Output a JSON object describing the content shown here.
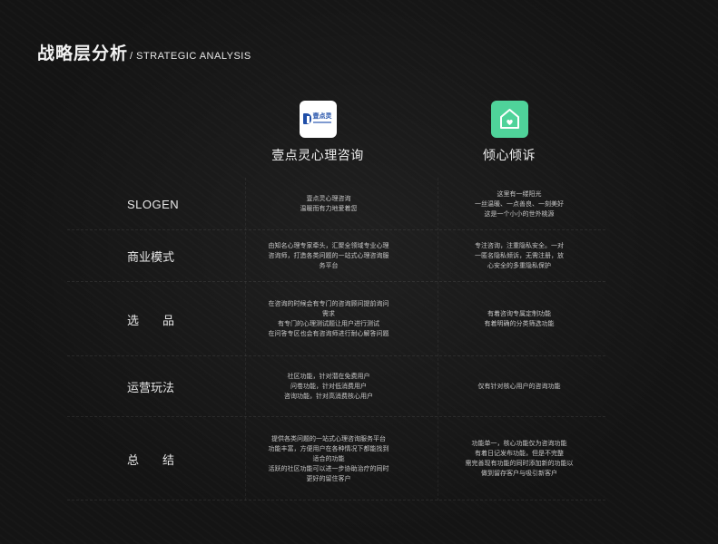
{
  "header": {
    "title_cn": "战略层分析",
    "title_en": "/ STRATEGIC ANALYSIS"
  },
  "apps": [
    {
      "name": "壹点灵心理咨询",
      "icon": "yidianling-logo-icon",
      "logo_text": "壹点灵",
      "brand_color": "#1f4ea8"
    },
    {
      "name": "倾心倾诉",
      "icon": "house-heart-icon",
      "brand_color": "#4fd39a"
    }
  ],
  "rows": [
    {
      "label": "SLOGEN",
      "col1": [
        "壹点灵心理咨询",
        "温暖而有力地爱着您"
      ],
      "col2": [
        "这里有一缕阳光",
        "一丝温暖、一点善良、一刻美好",
        "这是一个小小的世外桃源"
      ]
    },
    {
      "label": "商业模式",
      "col1": [
        "由知名心理专家牵头，汇聚全领域专业心理",
        "咨询师，打造各类问题的一站式心理咨询服",
        "务平台"
      ],
      "col2": [
        "专注咨询，注重隐私安全。一对",
        "一匿名隐私倾诉，无需注册，放",
        "心安全的多重隐私保护"
      ]
    },
    {
      "label": "选　　品",
      "col1": [
        "在咨询的时候会有专门的咨询顾问提前询问",
        "需求",
        "有专门的心理测试题让用户进行测试",
        "在问答专区也会有咨询师进行耐心解答问题"
      ],
      "col2": [
        "有着咨询专属定制功能",
        "有着明确的分类筛选功能"
      ]
    },
    {
      "label": "运营玩法",
      "col1": [
        "社区功能，针对潜在免费用户",
        "问卷功能，针对低消费用户",
        "咨询功能，针对高消费核心用户"
      ],
      "col2": [
        "仅有针对核心用户的咨询功能"
      ]
    },
    {
      "label": "总　　结",
      "col1": [
        "提供各类问题的一站式心理咨询服务平台",
        "功能丰富，方便用户在各种情况下都能找到",
        "适合的功能",
        "活跃的社区功能可以进一步协助治疗的同时",
        "更好的留住客户"
      ],
      "col2": [
        "功能单一，核心功能仅为咨询功能",
        "有着日记发布功能，但是不完整",
        "需完善现有功能的同时添加新的功能以",
        "做到留存客户与吸引新客户"
      ]
    }
  ]
}
